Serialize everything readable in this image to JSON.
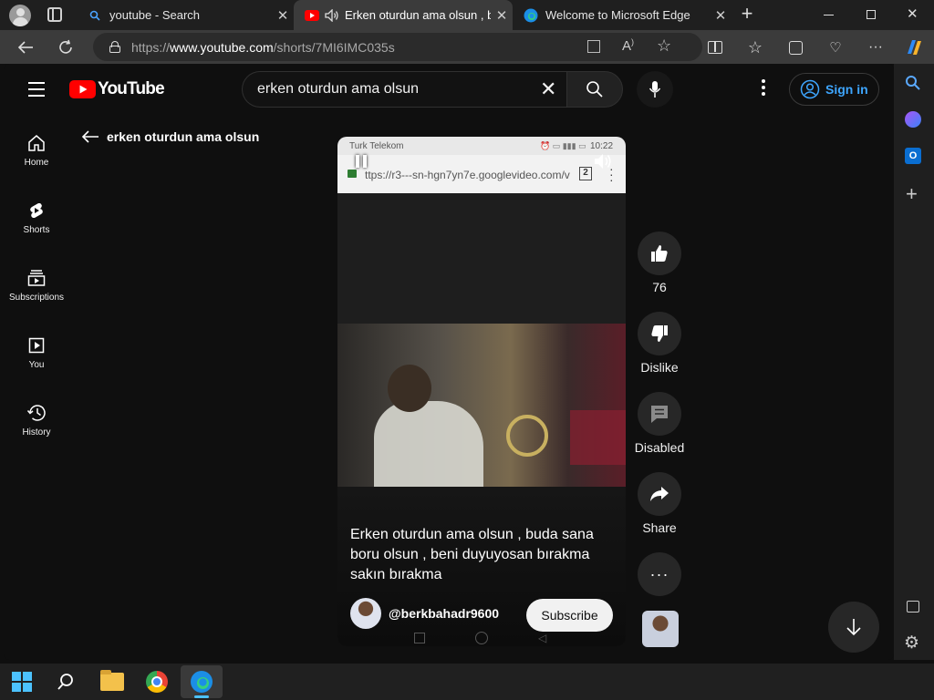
{
  "browser": {
    "tabs": [
      {
        "title": "youtube - Search",
        "icon": "search-icon"
      },
      {
        "title": "Erken oturdun ama olsun , b",
        "icon": "youtube-icon"
      },
      {
        "title": "Welcome to Microsoft Edge",
        "icon": "edge-icon"
      }
    ],
    "url_prefix": "https://",
    "url_host": "www.youtube.com",
    "url_path": "/shorts/7MI6IMC035s"
  },
  "youtube": {
    "logo_text": "YouTube",
    "search_value": "erken oturdun ama olsun",
    "sign_in_label": "Sign in",
    "back_label": "erken oturdun ama olsun",
    "nav": [
      {
        "label": "Home",
        "icon": "home-icon"
      },
      {
        "label": "Shorts",
        "icon": "shorts-icon"
      },
      {
        "label": "Subscriptions",
        "icon": "subscriptions-icon"
      },
      {
        "label": "You",
        "icon": "you-icon"
      },
      {
        "label": "History",
        "icon": "history-icon"
      }
    ]
  },
  "short": {
    "phone_status": {
      "carrier": "Turk Telekom",
      "time": "10:22"
    },
    "phone_url": "ttps://r3---sn-hgn7yn7e.googlevideo.com/v",
    "phone_tab_count": "2",
    "title": "Erken oturdun ama olsun , buda sana boru olsun , beni duyuyosan bırakma sakın bırakma",
    "channel": "@berkbahadr9600",
    "subscribe_label": "Subscribe",
    "actions": {
      "like_count": "76",
      "dislike_label": "Dislike",
      "comments_label": "Disabled",
      "share_label": "Share"
    }
  },
  "colors": {
    "youtube_red": "#ff0000",
    "link_blue": "#3ea6ff",
    "edge_bg": "#1f1f1f"
  }
}
